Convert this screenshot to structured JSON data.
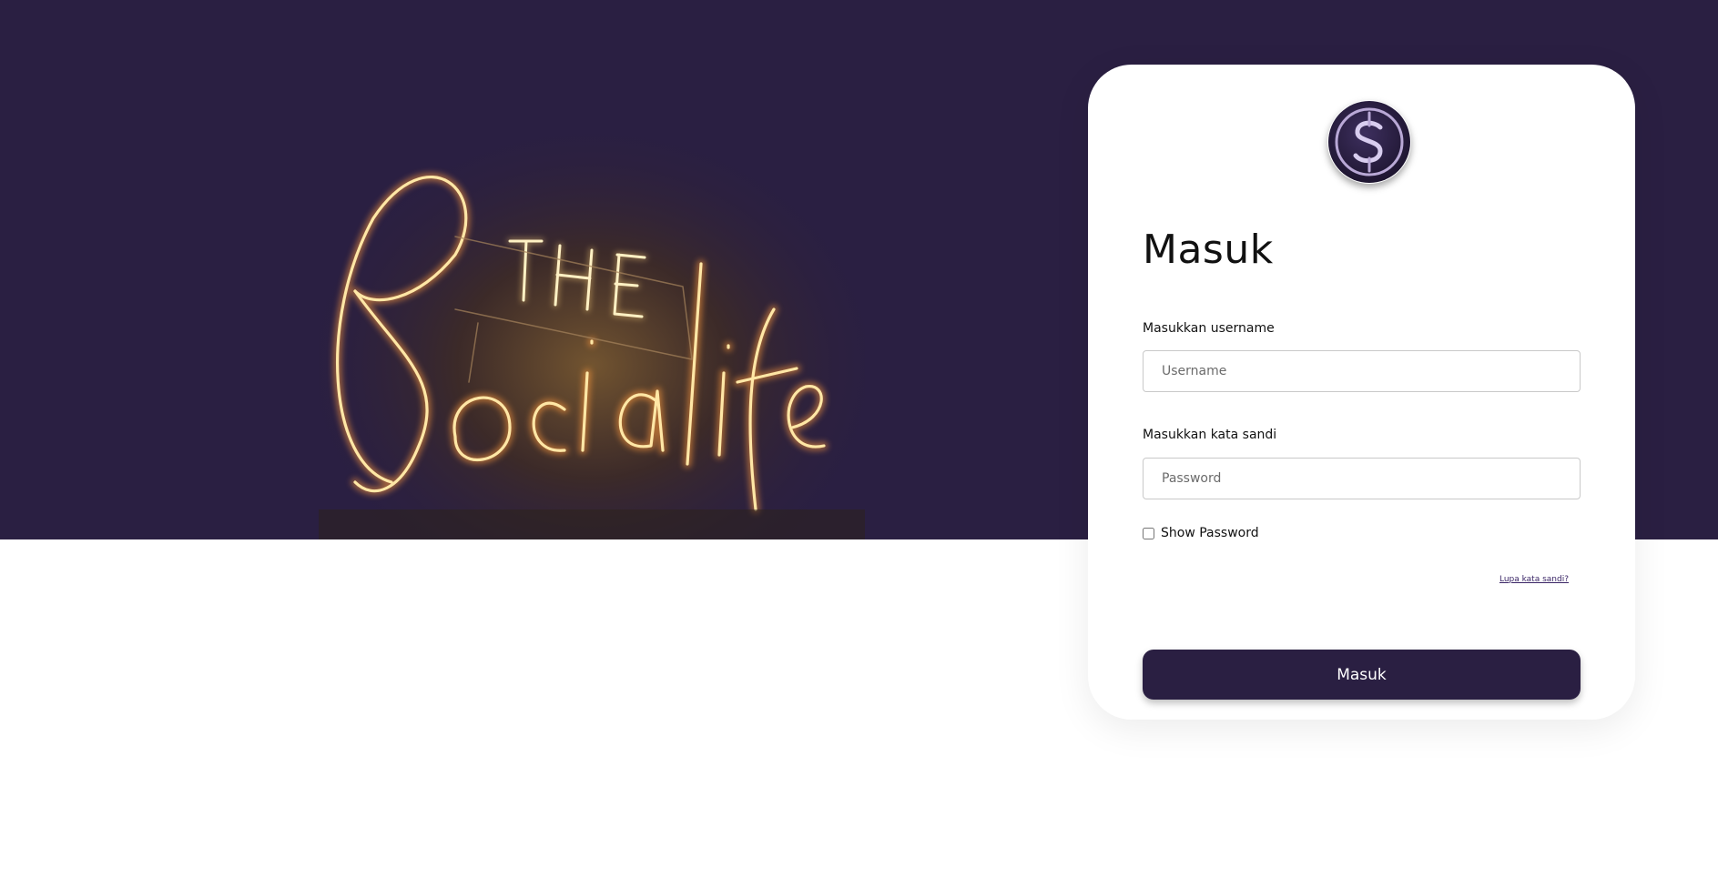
{
  "hero": {
    "image_alt": "neon-sign-the-socialite",
    "sign_text_top": "THE",
    "sign_text_script": "Socialite"
  },
  "login": {
    "logo_icon": "socialite-s-logo-icon",
    "title": "Masuk",
    "username": {
      "label": "Masukkan username",
      "placeholder": "Username",
      "value": ""
    },
    "password": {
      "label": "Masukkan kata sandi",
      "placeholder": "Password",
      "value": ""
    },
    "show_password_label": "Show Password",
    "show_password_checked": false,
    "forgot_password_label": "Lupa kata sandi?",
    "submit_label": "Masuk"
  },
  "colors": {
    "brand_dark": "#2a1f42",
    "neon": "#f5c65a",
    "background": "#ffffff"
  }
}
